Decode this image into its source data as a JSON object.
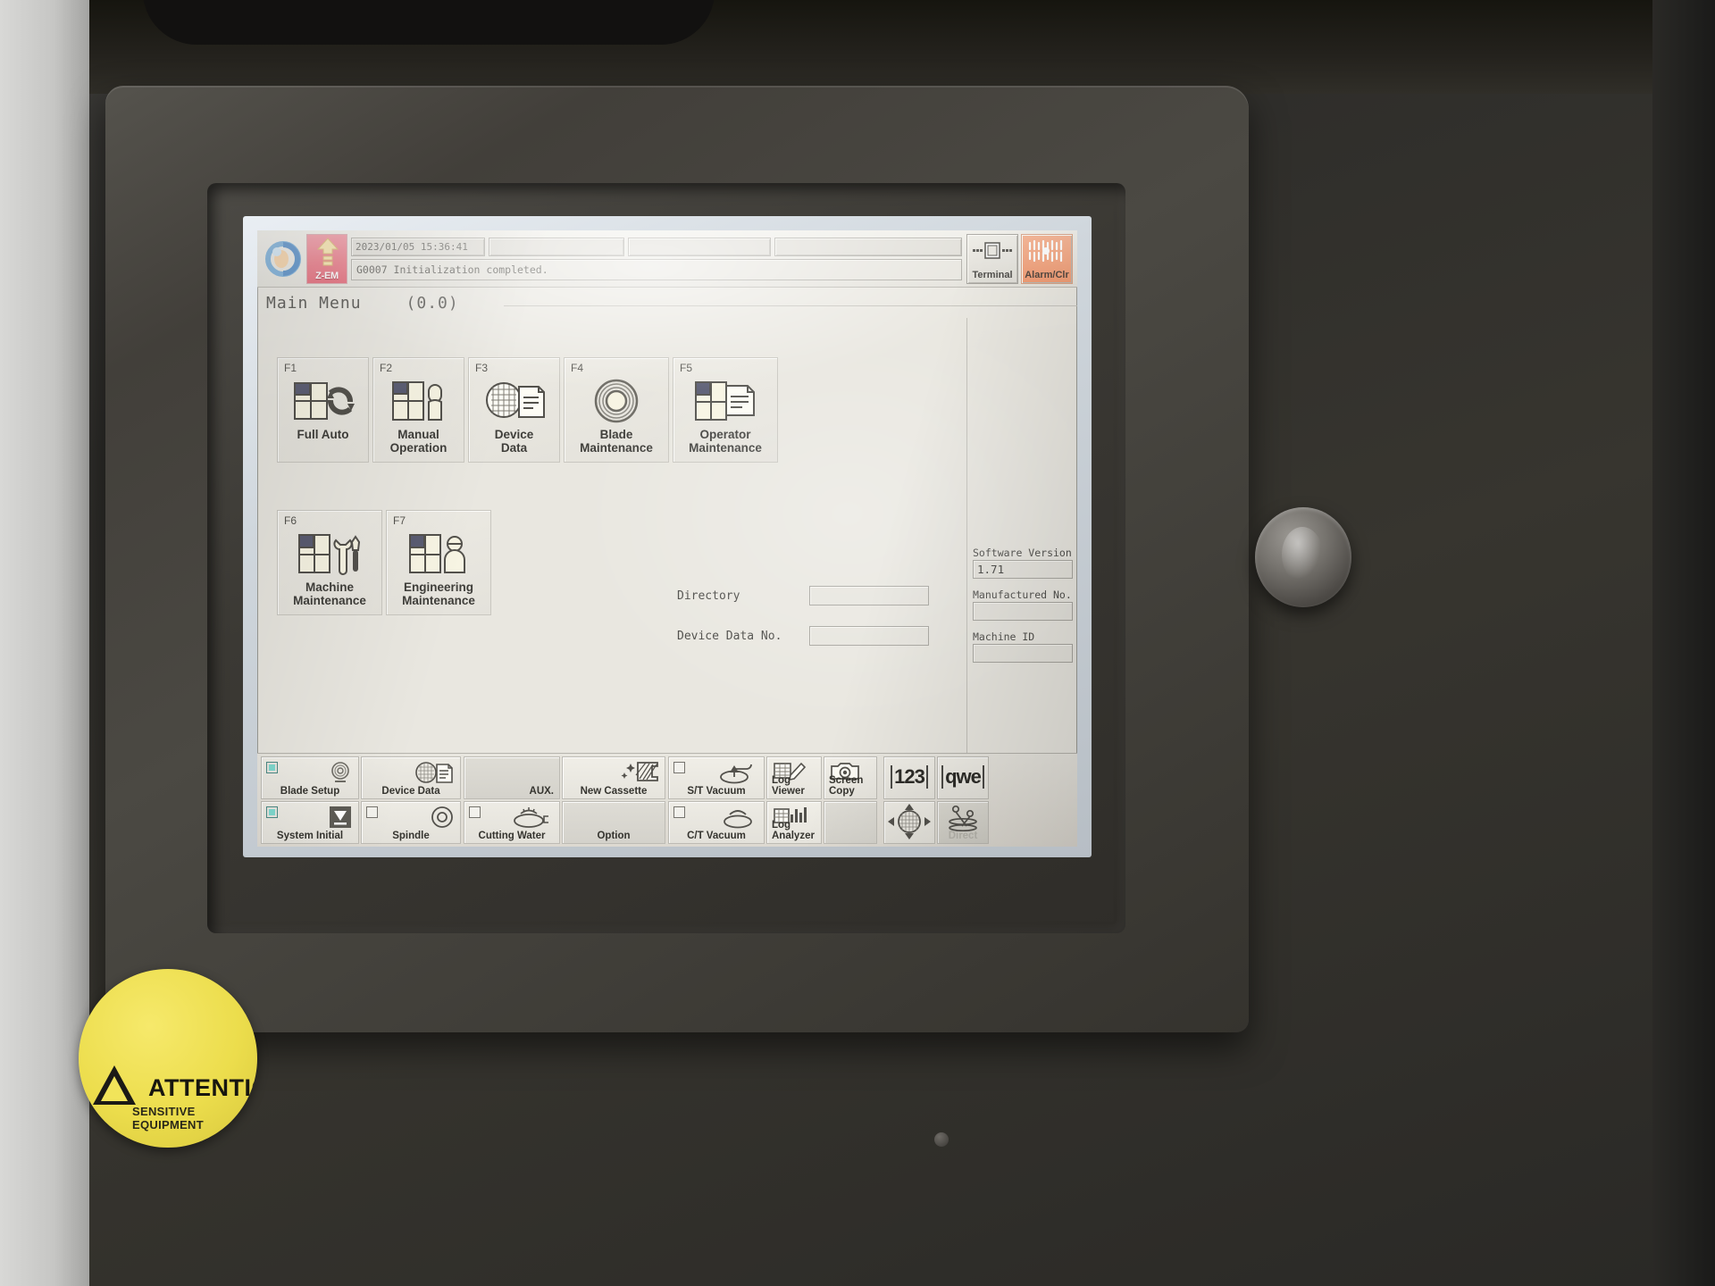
{
  "header": {
    "logo_icon": "globe-logo-icon",
    "mode_badge": {
      "label": "Z-EM",
      "icon": "up-arrow-icon"
    },
    "clock": "2023/01/05 15:36:41",
    "status_field_2": "",
    "status_field_3": "",
    "status_field_4": "",
    "message": "G0007  Initialization completed.",
    "buttons": [
      {
        "label": "Terminal",
        "icon": "terminal-icon"
      },
      {
        "label": "Alarm/Clr",
        "icon": "alarm-icon"
      }
    ]
  },
  "page": {
    "title": "Main Menu",
    "coordinate": "(0.0)"
  },
  "function_buttons": [
    {
      "key": "F1",
      "label": "Full Auto",
      "icon": "full-auto-icon"
    },
    {
      "key": "F2",
      "label": "Manual\nOperation",
      "label1": "Manual",
      "label2": "Operation",
      "icon": "manual-operation-icon"
    },
    {
      "key": "F3",
      "label": "Device\nData",
      "label1": "Device",
      "label2": "Data",
      "icon": "device-data-icon"
    },
    {
      "key": "F4",
      "label": "Blade\nMaintenance",
      "label1": "Blade",
      "label2": "Maintenance",
      "icon": "blade-maintenance-icon"
    },
    {
      "key": "F5",
      "label": "Operator\nMaintenance",
      "label1": "Operator",
      "label2": "Maintenance",
      "icon": "operator-maintenance-icon"
    },
    {
      "key": "F6",
      "label": "Machine\nMaintenance",
      "label1": "Machine",
      "label2": "Maintenance",
      "icon": "machine-maintenance-icon"
    },
    {
      "key": "F7",
      "label": "Engineering\nMaintenance",
      "label1": "Engineering",
      "label2": "Maintenance",
      "icon": "engineering-maintenance-icon"
    }
  ],
  "fields": {
    "directory_label": "Directory",
    "directory_value": "",
    "device_data_no_label": "Device Data No.",
    "device_data_no_value": ""
  },
  "info_panel": {
    "software_version_label": "Software Version",
    "software_version_value": "1.71",
    "manufactured_no_label": "Manufactured No.",
    "manufactured_no_value": "",
    "machine_id_label": "Machine ID",
    "machine_id_value": ""
  },
  "toolbar": {
    "blade_setup": {
      "label": "Blade Setup",
      "icon": "blade-icon",
      "checked": true
    },
    "system_initial": {
      "label": "System Initial",
      "icon": "system-initial-icon",
      "checked": true
    },
    "device_data": {
      "label": "Device Data",
      "icon": "device-data-icon",
      "checked": false
    },
    "spindle": {
      "label": "Spindle",
      "icon": "spindle-icon",
      "checked": false
    },
    "aux": {
      "label": "AUX.",
      "icon": "",
      "checked": false
    },
    "cutting_water": {
      "label": "Cutting Water",
      "icon": "cutting-water-icon",
      "checked": false
    },
    "new_cassette": {
      "label": "New Cassette",
      "icon": "new-cassette-icon",
      "checked": false
    },
    "option": {
      "label": "Option",
      "icon": "",
      "checked": false
    },
    "st_vacuum": {
      "label": "S/T Vacuum",
      "icon": "st-vacuum-icon",
      "checked": false
    },
    "ct_vacuum": {
      "label": "C/T Vacuum",
      "icon": "ct-vacuum-icon",
      "checked": false
    },
    "log_viewer": {
      "label1": "Log",
      "label2": "Viewer",
      "icon": "log-viewer-icon"
    },
    "log_analyzer": {
      "label1": "Log",
      "label2": "Analyzer",
      "icon": "log-analyzer-icon"
    },
    "screen_copy": {
      "label1": "Screen",
      "label2": "Copy",
      "icon": "camera-icon"
    },
    "numeric_keypad": {
      "label": "123",
      "icon": "numeric-keypad-icon"
    },
    "text_keypad": {
      "label": "qwe",
      "icon": "text-keypad-icon"
    },
    "navigation": {
      "label": "",
      "icon": "dpad-wafer-icon"
    },
    "direct": {
      "label": "Direct",
      "icon": "direct-icon"
    }
  },
  "machine_sticker": {
    "title": "ATTENTION",
    "subtitle": "SENSITIVE EQUIPMENT"
  }
}
